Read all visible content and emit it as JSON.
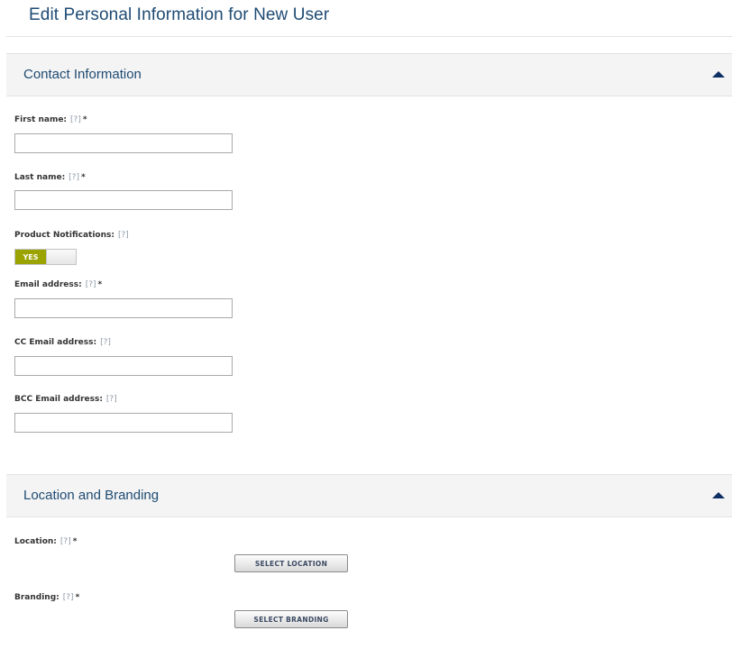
{
  "page": {
    "title": "Edit Personal Information for New User"
  },
  "contact": {
    "title": "Contact Information",
    "collapse_icon": "chevron-up-icon",
    "first_name": {
      "label": "First name:",
      "help": "[?]",
      "required": "*",
      "value": ""
    },
    "last_name": {
      "label": "Last name:",
      "help": "[?]",
      "required": "*",
      "value": ""
    },
    "product_notifications": {
      "label": "Product Notifications:",
      "help": "[?]",
      "toggle_text": "YES",
      "toggle_state": "on"
    },
    "email": {
      "label": "Email address:",
      "help": "[?]",
      "required": "*",
      "value": ""
    },
    "cc_email": {
      "label": "CC Email address:",
      "help": "[?]",
      "value": ""
    },
    "bcc_email": {
      "label": "BCC Email address:",
      "help": "[?]",
      "value": ""
    }
  },
  "location_branding": {
    "title": "Location and Branding",
    "collapse_icon": "chevron-up-icon",
    "location": {
      "label": "Location:",
      "help": "[?]",
      "required": "*",
      "button": "SELECT LOCATION"
    },
    "branding": {
      "label": "Branding:",
      "help": "[?]",
      "required": "*",
      "button": "SELECT BRANDING"
    }
  },
  "colors": {
    "title_text": "#1f4b73",
    "toggle_on": "#9aa300",
    "section_bg": "#f4f4f4",
    "collapse_arrow": "#0d2f63"
  }
}
